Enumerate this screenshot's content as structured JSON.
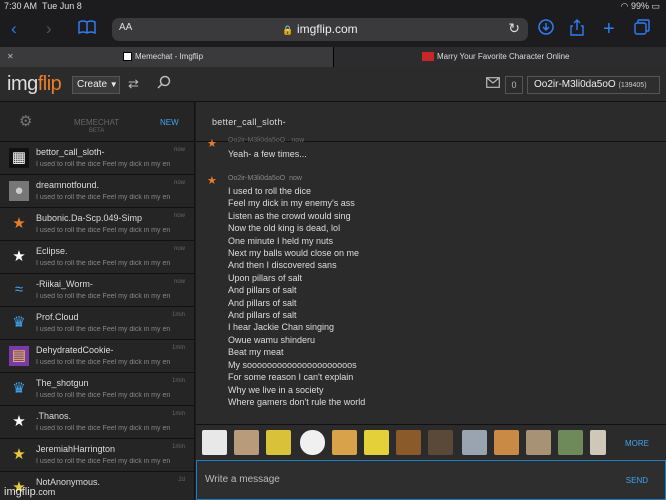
{
  "status": {
    "time": "7:30 AM",
    "day": "Tue Jun 8",
    "battery": "99%"
  },
  "browser": {
    "aa": "AA",
    "url": "imgflip.com",
    "tabs": [
      {
        "title": "Memechat - Imgflip",
        "favicon": "imgflip"
      },
      {
        "title": "Marry Your Favorite Character Online",
        "favicon": "mfyc"
      }
    ]
  },
  "app": {
    "logo_main": "img",
    "logo_accent": "flip",
    "create_label": "Create",
    "mail_count": "0",
    "username": "Oo2ir-M3li0da5oO",
    "points": "(139405)"
  },
  "sidebar": {
    "title": "MEMECHAT",
    "subtitle": "BETA",
    "new_label": "NEW",
    "conversations": [
      {
        "name": "bettor_call_sloth-",
        "preview": "I used to roll the dice Feel my dick in my en",
        "time": "now",
        "avatar": "pattern"
      },
      {
        "name": "dreamnotfound.",
        "preview": "I used to roll the dice Feel my dick in my en",
        "time": "now",
        "avatar": "person"
      },
      {
        "name": "Bubonic.Da-Scp.049-Simp",
        "preview": "I used to roll the dice Feel my dick in my en",
        "time": "now",
        "avatar": "star"
      },
      {
        "name": "Eclipse.",
        "preview": "I used to roll the dice Feel my dick in my en",
        "time": "now",
        "avatar": "star"
      },
      {
        "name": "-Riikai_Worm-",
        "preview": "I used to roll the dice Feel my dick in my en",
        "time": "now",
        "avatar": "fish"
      },
      {
        "name": "Prof.Cloud",
        "preview": "I used to roll the dice Feel my dick in my en",
        "time": "1min",
        "avatar": "crown"
      },
      {
        "name": "DehydratedCookie-",
        "preview": "I used to roll the dice Feel my dick in my en",
        "time": "1min",
        "avatar": "rainbow"
      },
      {
        "name": "The_shotgun",
        "preview": "I used to roll the dice Feel my dick in my en",
        "time": "1min",
        "avatar": "crown"
      },
      {
        "name": ".Thanos.",
        "preview": "I used to roll the dice Feel my dick in my en",
        "time": "1min",
        "avatar": "star"
      },
      {
        "name": "JeremiahHarrington",
        "preview": "I used to roll the dice Feel my dick in my en",
        "time": "1min",
        "avatar": "star"
      },
      {
        "name": "NotAnonymous.",
        "preview": "",
        "time": "2d",
        "avatar": "star"
      }
    ]
  },
  "chat": {
    "title": "better_call_sloth-",
    "prev_message": "Yeah- a few times...",
    "author": "Oo2ir-M3li0da5oO",
    "author_time": "now",
    "lines": [
      "I used to roll the dice",
      "Feel my dick in my enemy's ass",
      "Listen as the crowd would sing",
      "Now the old king is dead, lol",
      "One minute I held my nuts",
      "Next my balls would close on me",
      "And then I discovered sans",
      "Upon pillars of salt",
      "And pillars of salt",
      "And pillars of salt",
      "And pillars of salt",
      "I hear Jackie Chan singing",
      "Owue wamu shinderu",
      "Beat my meat",
      "My sooooooooooooooooooooos",
      "For some reason I can't explain",
      "Why we live in a society",
      "Where gamers don't rule the world"
    ],
    "more_label": "MORE",
    "compose_placeholder": "Write a message",
    "send_label": "SEND"
  },
  "watermark": {
    "brand": "imgflip",
    "tld": ".com"
  },
  "colors": {
    "accent": "#3ea4f0",
    "brand_orange": "#e87e2a",
    "safari_blue": "#2f7cf6"
  }
}
